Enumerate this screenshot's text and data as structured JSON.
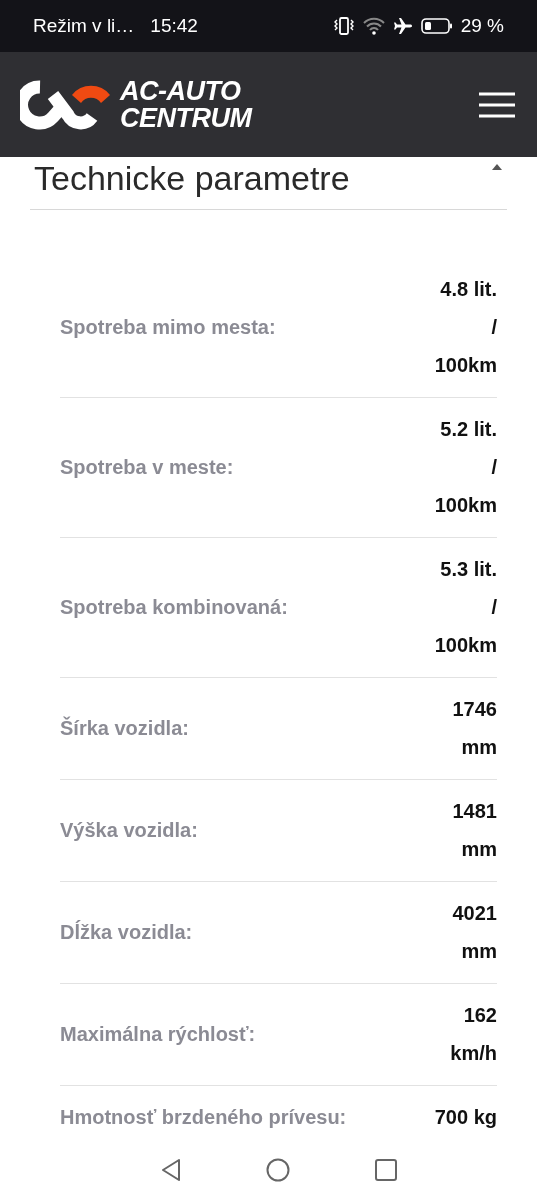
{
  "status_bar": {
    "mode": "Režim v li…",
    "time": "15:42",
    "battery": "29 %"
  },
  "header": {
    "brand_line_1": "AC-AUTO",
    "brand_line_2": "CENTRUM"
  },
  "section": {
    "title": "Technicke parametre",
    "expanded": true
  },
  "parameters": [
    {
      "label": "Spotreba mimo mesta:",
      "value": "4.8 lit. / 100km"
    },
    {
      "label": "Spotreba v meste:",
      "value": "5.2 lit. / 100km"
    },
    {
      "label": "Spotreba kombinovaná:",
      "value": "5.3 lit. / 100km"
    },
    {
      "label": "Šírka vozidla:",
      "value": "1746 mm"
    },
    {
      "label": "Výška vozidla:",
      "value": "1481 mm"
    },
    {
      "label": "Dĺžka vozidla:",
      "value": "4021 mm"
    },
    {
      "label": "Maximálna rýchlosť:",
      "value": "162 km/h"
    },
    {
      "label": "Hmotnosť brzdeného prívesu:",
      "value": "700 kg"
    }
  ]
}
